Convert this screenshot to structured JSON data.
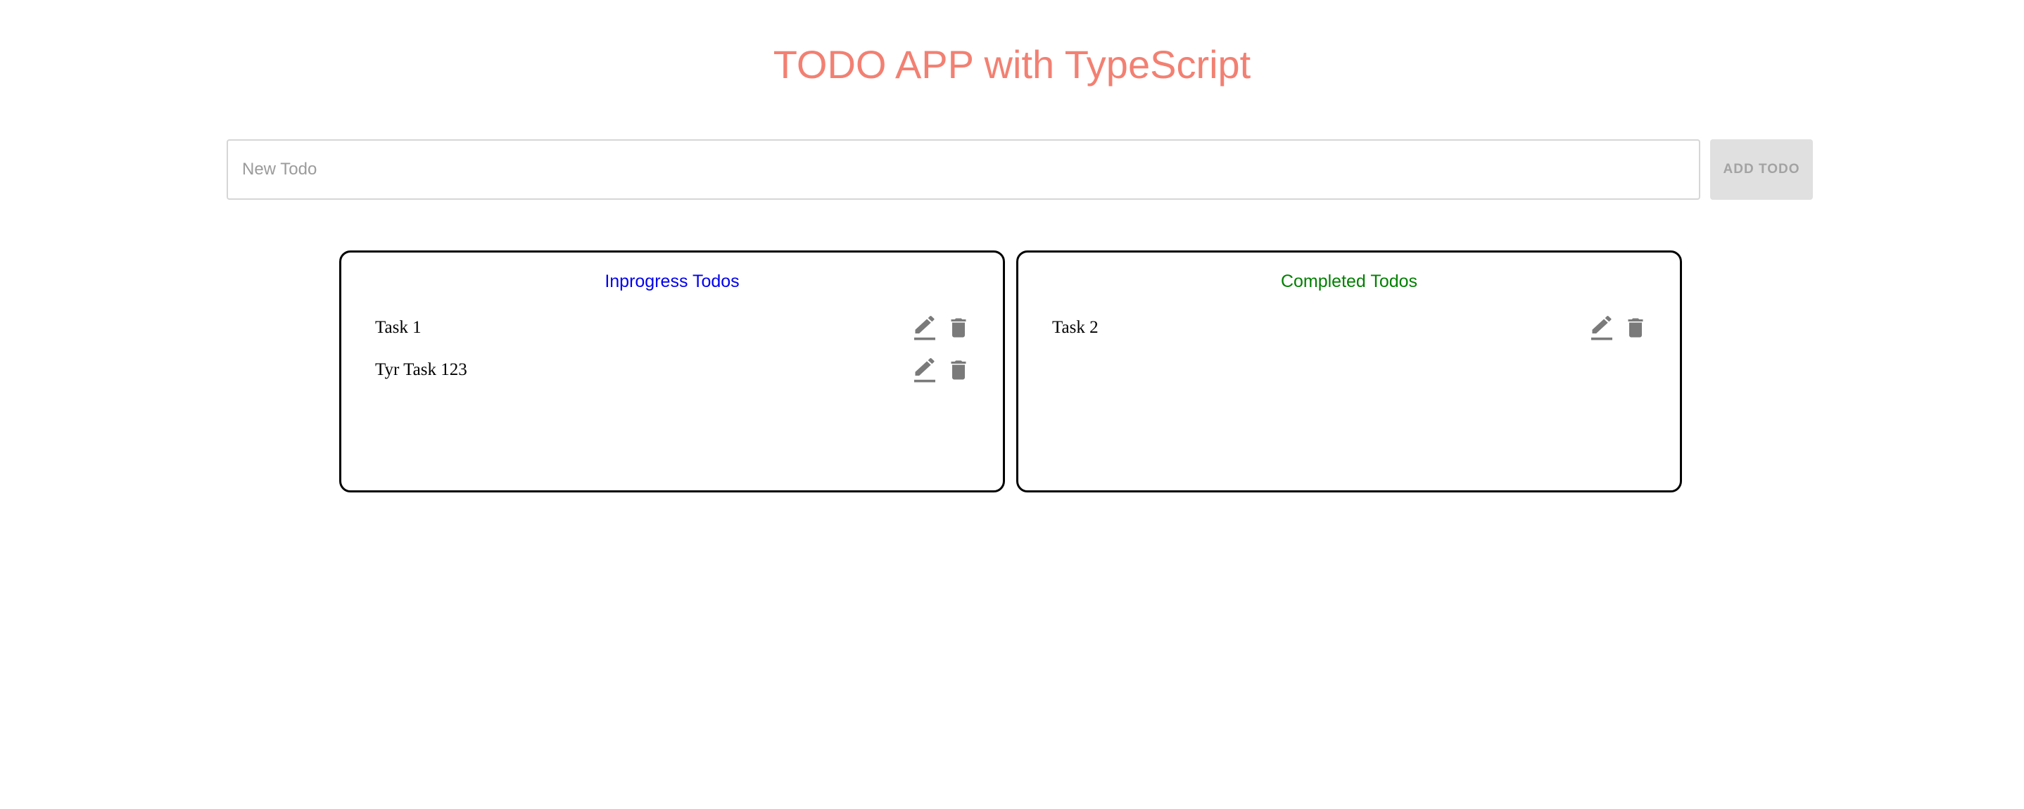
{
  "app": {
    "title": "TODO APP with TypeScript",
    "title_color": "#f28072"
  },
  "new_todo": {
    "value": "",
    "placeholder": "New Todo",
    "add_button_label": "ADD TODO"
  },
  "panels": {
    "inprogress": {
      "title": "Inprogress Todos",
      "title_color": "#0000ee",
      "items": [
        {
          "text": "Task 1",
          "edit_icon": "edit-icon",
          "delete_icon": "delete-icon"
        },
        {
          "text": "Tyr Task 123",
          "edit_icon": "edit-icon",
          "delete_icon": "delete-icon"
        }
      ]
    },
    "completed": {
      "title": "Completed Todos",
      "title_color": "#008000",
      "items": [
        {
          "text": "Task 2",
          "edit_icon": "edit-icon",
          "delete_icon": "delete-icon"
        }
      ]
    }
  },
  "icon_color": "#7a7a7a"
}
